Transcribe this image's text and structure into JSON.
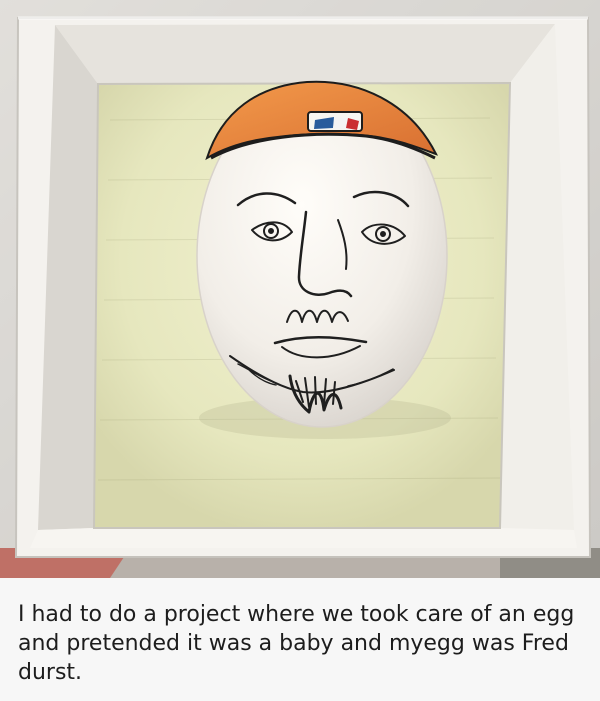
{
  "post": {
    "caption": "I had to do a project where we took care of an egg and pretended it was a baby and myegg was Fred durst."
  },
  "image": {
    "subject_icon": "egg-face-drawing",
    "colors": {
      "box_outer": "#f4f2ee",
      "box_inner": "#dedbd5",
      "foam": "#e6e7be",
      "egg": "#f5f2ec",
      "cap": "#ed8b3f",
      "ink": "#1f1f1f"
    }
  }
}
